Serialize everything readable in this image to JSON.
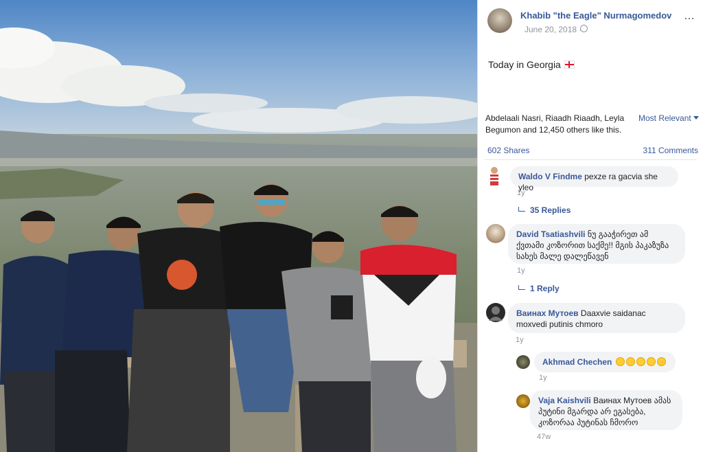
{
  "post": {
    "author": "Khabib \"the Eagle\" Nurmagomedov",
    "date": "June 20, 2018 ·",
    "text": "Today in Georgia",
    "likes_text": "Abdelaali Nasri, Riaadh Riaadh, Leyla Begumon and 12,450 others like this.",
    "sort_label": "Most Relevant",
    "shares": "602 Shares",
    "comments_count": "311 Comments"
  },
  "comments": [
    {
      "name": "Waldo V Findme",
      "text": "pexze ra gacvia she yleo",
      "time": "1y",
      "replies": "35 Replies"
    },
    {
      "name": "David Tsatiashvili",
      "text": "ნუ გააჭირეთ ამ ქვთამი კოზორით საქმე!! მგის პაკაზუზა სახეს მალე დალეწავენ",
      "time": "1y",
      "replies": "1 Reply"
    },
    {
      "name": "Ваинах Мутоев",
      "text": "Daaxvie saidanac moxvedi putinis chmoro",
      "time": "1y"
    },
    {
      "name": "Akhmad Chechen",
      "text": "",
      "time": "1y"
    },
    {
      "name": "Vaja Kaishvili",
      "text": "Ваинах Мутоев ამას პუტინი მგარდა არ ეგასება, კოზორაა პუტინას ჩმორო",
      "time": "47w"
    }
  ],
  "colors": {
    "link": "#385898",
    "bubble": "#f2f3f5"
  },
  "icons": [
    "globe-icon",
    "more-icon",
    "flag-icon",
    "reply-arrow-icon",
    "laughing-emoji-icon"
  ]
}
